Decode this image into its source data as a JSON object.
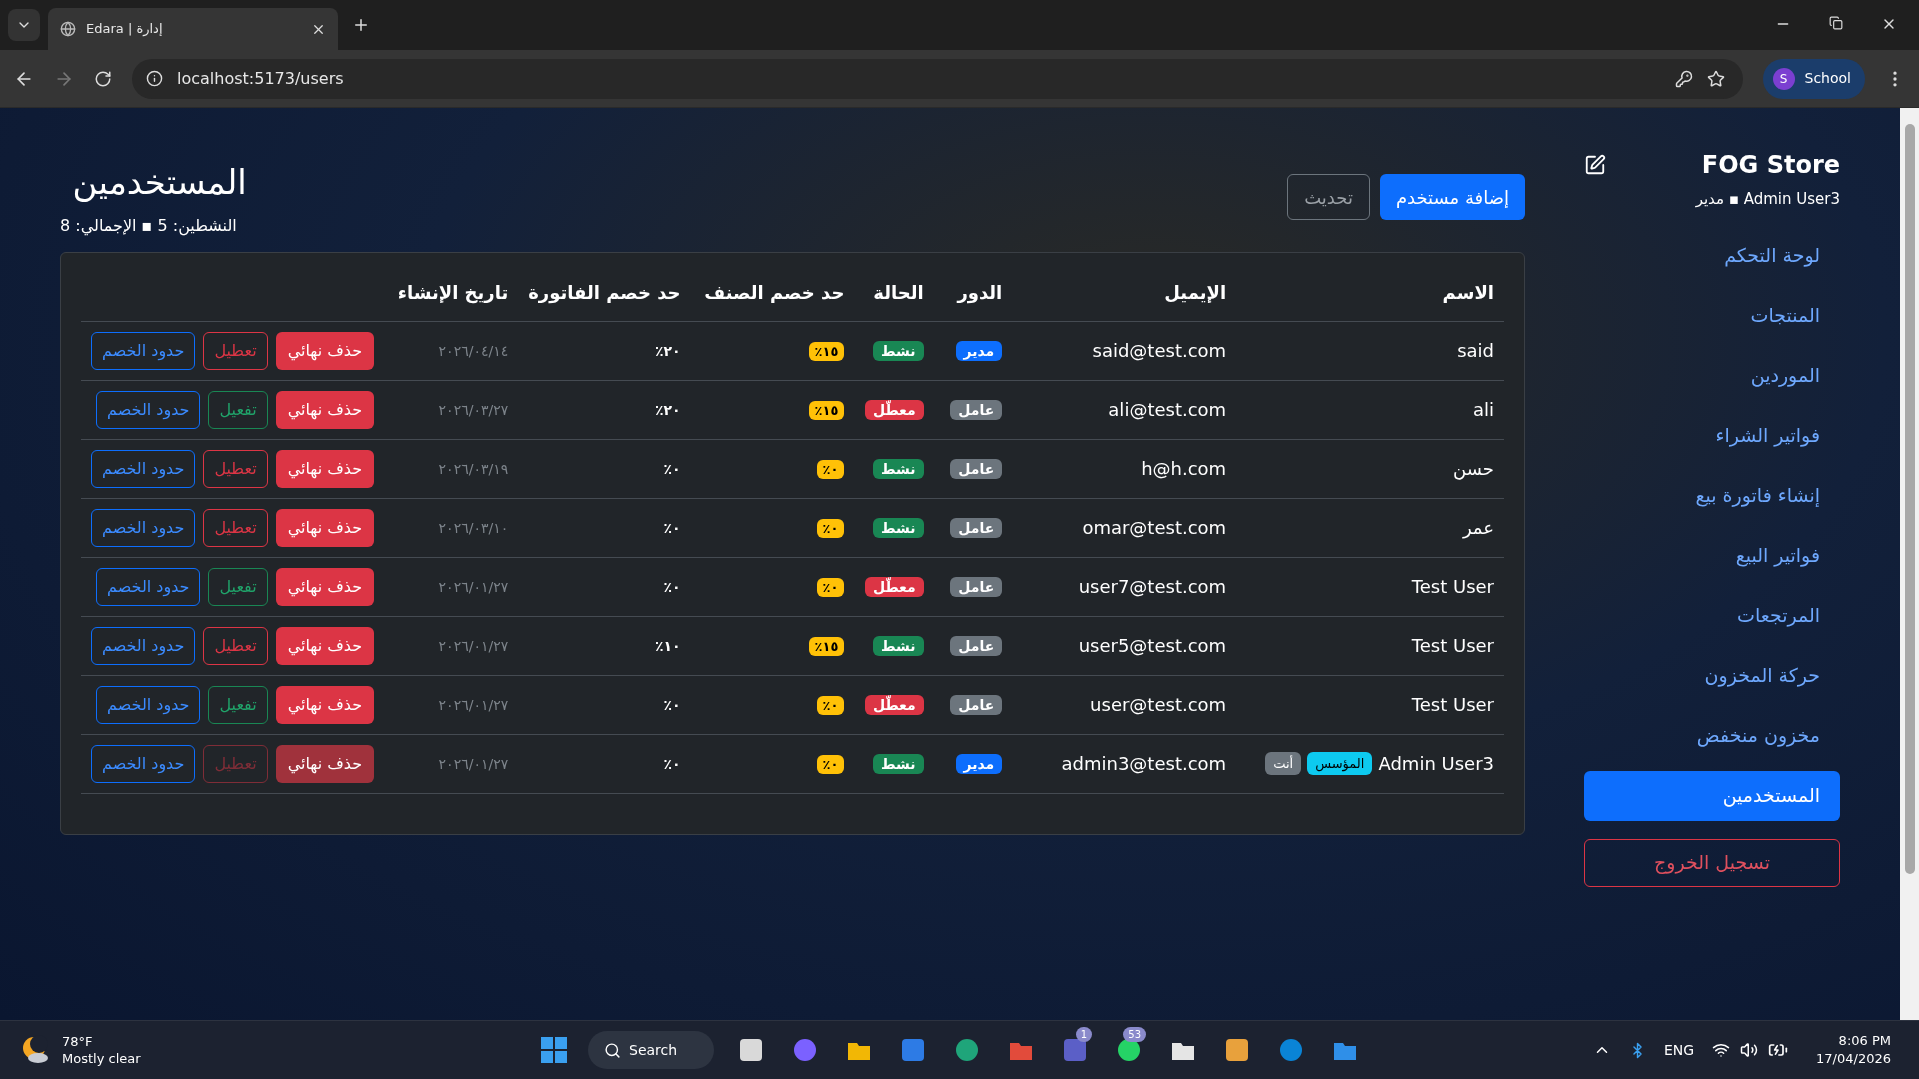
{
  "browser": {
    "tab_title": "Edara | إدارة",
    "url": "localhost:5173/users",
    "profile_initial": "S",
    "profile_name": "School"
  },
  "page": {
    "title": "المستخدمين",
    "summary": "النشطين: 5 ▪ الإجمالي: 8",
    "add_button": "إضافة مستخدم",
    "refresh_button": "تحديث"
  },
  "table": {
    "columns": [
      "الاسم",
      "الإيميل",
      "الدور",
      "الحالة",
      "حد خصم الصنف",
      "حد خصم الفاتورة",
      "تاريخ الإنشاء"
    ],
    "rows": [
      {
        "name": "said",
        "badges": [],
        "email": "said@test.com",
        "role": {
          "label": "مدير",
          "kind": "admin"
        },
        "status": {
          "label": "نشط",
          "active": true
        },
        "item_limit": "١٥٪",
        "invoice_limit": "٢٠٪",
        "created": "٢٠٢٦/٠٤/١٤",
        "delete": {
          "label": "حذف نهائي",
          "disabled": false
        },
        "toggle": {
          "label": "تعطيل",
          "kind": "deactivate",
          "disabled": false
        },
        "limits": "حدود الخصم"
      },
      {
        "name": "ali",
        "badges": [],
        "email": "ali@test.com",
        "role": {
          "label": "عامل",
          "kind": "worker"
        },
        "status": {
          "label": "معطّل",
          "active": false
        },
        "item_limit": "١٥٪",
        "invoice_limit": "٢٠٪",
        "created": "٢٠٢٦/٠٣/٢٧",
        "delete": {
          "label": "حذف نهائي",
          "disabled": false
        },
        "toggle": {
          "label": "تفعيل",
          "kind": "activate",
          "disabled": false
        },
        "limits": "حدود الخصم"
      },
      {
        "name": "حسن",
        "badges": [],
        "email": "h@h.com",
        "role": {
          "label": "عامل",
          "kind": "worker"
        },
        "status": {
          "label": "نشط",
          "active": true
        },
        "item_limit": "٠٪",
        "invoice_limit": "٠٪",
        "created": "٢٠٢٦/٠٣/١٩",
        "delete": {
          "label": "حذف نهائي",
          "disabled": false
        },
        "toggle": {
          "label": "تعطيل",
          "kind": "deactivate",
          "disabled": false
        },
        "limits": "حدود الخصم"
      },
      {
        "name": "عمر",
        "badges": [],
        "email": "omar@test.com",
        "role": {
          "label": "عامل",
          "kind": "worker"
        },
        "status": {
          "label": "نشط",
          "active": true
        },
        "item_limit": "٠٪",
        "invoice_limit": "٠٪",
        "created": "٢٠٢٦/٠٣/١٠",
        "delete": {
          "label": "حذف نهائي",
          "disabled": false
        },
        "toggle": {
          "label": "تعطيل",
          "kind": "deactivate",
          "disabled": false
        },
        "limits": "حدود الخصم"
      },
      {
        "name": "Test User",
        "badges": [],
        "email": "user7@test.com",
        "role": {
          "label": "عامل",
          "kind": "worker"
        },
        "status": {
          "label": "معطّل",
          "active": false
        },
        "item_limit": "٠٪",
        "invoice_limit": "٠٪",
        "created": "٢٠٢٦/٠١/٢٧",
        "delete": {
          "label": "حذف نهائي",
          "disabled": false
        },
        "toggle": {
          "label": "تفعيل",
          "kind": "activate",
          "disabled": false
        },
        "limits": "حدود الخصم"
      },
      {
        "name": "Test User",
        "badges": [],
        "email": "user5@test.com",
        "role": {
          "label": "عامل",
          "kind": "worker"
        },
        "status": {
          "label": "نشط",
          "active": true
        },
        "item_limit": "١٥٪",
        "invoice_limit": "١٠٪",
        "created": "٢٠٢٦/٠١/٢٧",
        "delete": {
          "label": "حذف نهائي",
          "disabled": false
        },
        "toggle": {
          "label": "تعطيل",
          "kind": "deactivate",
          "disabled": false
        },
        "limits": "حدود الخصم"
      },
      {
        "name": "Test User",
        "badges": [],
        "email": "user@test.com",
        "role": {
          "label": "عامل",
          "kind": "worker"
        },
        "status": {
          "label": "معطّل",
          "active": false
        },
        "item_limit": "٠٪",
        "invoice_limit": "٠٪",
        "created": "٢٠٢٦/٠١/٢٧",
        "delete": {
          "label": "حذف نهائي",
          "disabled": false
        },
        "toggle": {
          "label": "تفعيل",
          "kind": "activate",
          "disabled": false
        },
        "limits": "حدود الخصم"
      },
      {
        "name": "Admin User3",
        "badges": [
          {
            "label": "المؤسس",
            "kind": "founder"
          },
          {
            "label": "أنت",
            "kind": "self"
          }
        ],
        "email": "admin3@test.com",
        "role": {
          "label": "مدير",
          "kind": "admin"
        },
        "status": {
          "label": "نشط",
          "active": true
        },
        "item_limit": "٠٪",
        "invoice_limit": "٠٪",
        "created": "٢٠٢٦/٠١/٢٧",
        "delete": {
          "label": "حذف نهائي",
          "disabled": true
        },
        "toggle": {
          "label": "تعطيل",
          "kind": "deactivate",
          "disabled": true
        },
        "limits": "حدود الخصم"
      }
    ]
  },
  "sidebar": {
    "brand": "FOG Store",
    "user_line": "Admin User3 ▪ مدير",
    "items": [
      {
        "label": "لوحة التحكم",
        "selected": false
      },
      {
        "label": "المنتجات",
        "selected": false
      },
      {
        "label": "الموردين",
        "selected": false
      },
      {
        "label": "فواتير الشراء",
        "selected": false
      },
      {
        "label": "إنشاء فاتورة بيع",
        "selected": false
      },
      {
        "label": "فواتير البيع",
        "selected": false
      },
      {
        "label": "المرتجعات",
        "selected": false
      },
      {
        "label": "حركة المخزون",
        "selected": false
      },
      {
        "label": "مخزون منخفض",
        "selected": false
      },
      {
        "label": "المستخدمين",
        "selected": true
      }
    ],
    "logout": "تسجيل الخروج"
  },
  "taskbar": {
    "temperature": "78°F",
    "weather": "Mostly clear",
    "search": "Search",
    "people_app_badge": "1",
    "messages_app_badge": "53",
    "language": "ENG",
    "time": "8:06 PM",
    "date": "17/04/2026"
  }
}
